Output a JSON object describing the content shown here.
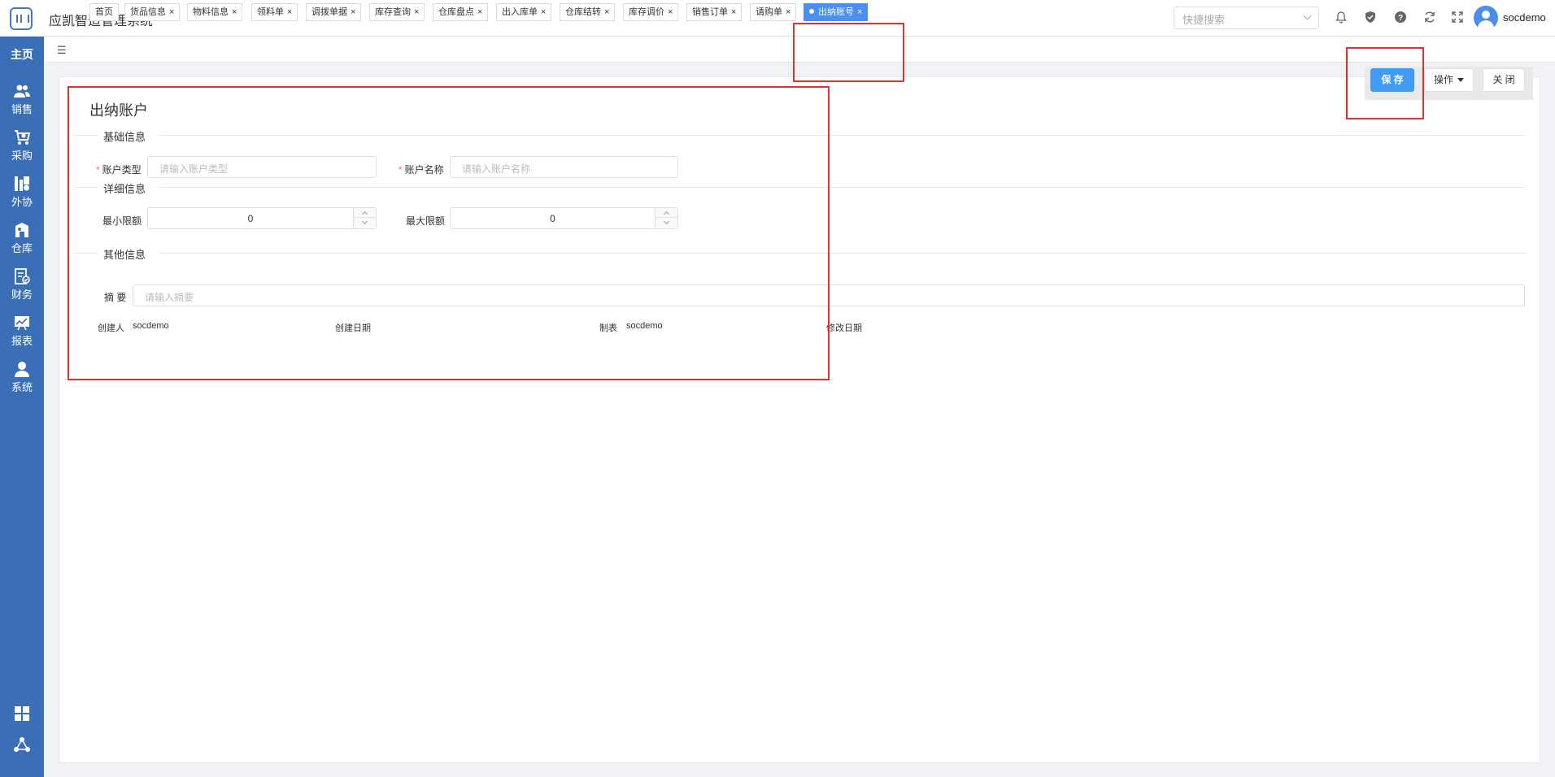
{
  "header": {
    "app_title": "应凯智造管理系统",
    "search_placeholder": "快捷搜索",
    "username": "socdemo",
    "icons": [
      "bell-icon",
      "shield-icon",
      "help-icon",
      "refresh-icon",
      "fullscreen-icon"
    ]
  },
  "sidebar": {
    "home": "主页",
    "items": [
      {
        "label": "销售",
        "icon": "users-icon"
      },
      {
        "label": "采购",
        "icon": "cart-icon"
      },
      {
        "label": "外协",
        "icon": "outsource-icon"
      },
      {
        "label": "仓库",
        "icon": "warehouse-icon"
      },
      {
        "label": "财务",
        "icon": "finance-icon"
      },
      {
        "label": "报表",
        "icon": "report-icon"
      },
      {
        "label": "系统",
        "icon": "user-icon"
      }
    ],
    "bottom_icons": [
      "grid-icon",
      "share-icon"
    ]
  },
  "tabs": [
    {
      "label": "首页",
      "closable": false
    },
    {
      "label": "货品信息",
      "closable": true
    },
    {
      "label": "物料信息",
      "closable": true
    },
    {
      "label": "领料单",
      "closable": true
    },
    {
      "label": "调拨单据",
      "closable": true
    },
    {
      "label": "库存查询",
      "closable": true
    },
    {
      "label": "仓库盘点",
      "closable": true
    },
    {
      "label": "出入库单",
      "closable": true
    },
    {
      "label": "仓库结转",
      "closable": true
    },
    {
      "label": "库存调价",
      "closable": true
    },
    {
      "label": "销售订单",
      "closable": true
    },
    {
      "label": "请购单",
      "closable": true
    },
    {
      "label": "出纳账号",
      "closable": true,
      "active": true
    }
  ],
  "actions": {
    "save": "保 存",
    "operate": "操作",
    "close": "关 闭"
  },
  "form": {
    "title": "出纳账户",
    "sections": {
      "basic": "基础信息",
      "detail": "详细信息",
      "other": "其他信息"
    },
    "account_type": {
      "label": "账户类型",
      "placeholder": "请输入账户类型",
      "required": true
    },
    "account_name": {
      "label": "账户名称",
      "placeholder": "请输入账户名称",
      "required": true
    },
    "min_limit": {
      "label": "最小限额",
      "value": "0"
    },
    "max_limit": {
      "label": "最大限额",
      "value": "0"
    },
    "summary": {
      "label": "摘 要",
      "placeholder": "请输入摘要"
    },
    "meta": {
      "creator_label": "创建人",
      "creator_value": "socdemo",
      "created_date_label": "创建日期",
      "maker_label": "制表",
      "maker_value": "socdemo",
      "modified_date_label": "修改日期"
    }
  },
  "colors": {
    "sidebar": "#3a6fb8",
    "primary": "#3f9cf4",
    "active_tab": "#4a90f0",
    "annotation": "#e03131"
  }
}
